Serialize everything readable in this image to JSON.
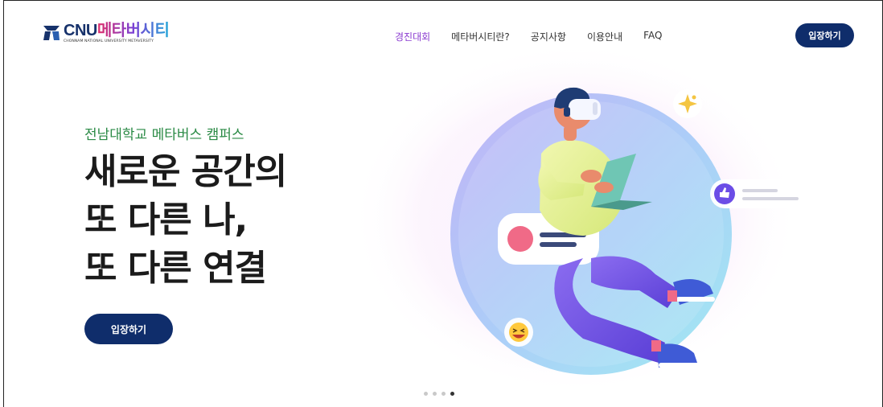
{
  "brand": {
    "main_cnu": "CNU",
    "main_meta": "메타버시티",
    "sub": "CHONNAM NATIONAL UNIVERSITY METAVERSITY"
  },
  "nav": {
    "items": [
      {
        "label": "경진대회",
        "active": true
      },
      {
        "label": "메타버시티란?",
        "active": false
      },
      {
        "label": "공지사항",
        "active": false
      },
      {
        "label": "이용안내",
        "active": false
      },
      {
        "label": "FAQ",
        "active": false
      }
    ]
  },
  "header": {
    "enter_label": "입장하기"
  },
  "hero": {
    "subtitle": "전남대학교 메타버스 캠퍼스",
    "lines": [
      "새로운 공간의",
      "또 다른 나,",
      "또 다른 연결"
    ],
    "enter_label": "입장하기"
  },
  "carousel": {
    "total": 4,
    "active_index": 4
  },
  "colors": {
    "navy": "#0f2d6b",
    "active_nav": "#8a3bd0",
    "subtitle_green": "#2a8a45"
  },
  "icons": [
    "logo-emblem-icon",
    "sparkle-icon",
    "thumbs-up-icon",
    "laughing-emoji-icon"
  ]
}
